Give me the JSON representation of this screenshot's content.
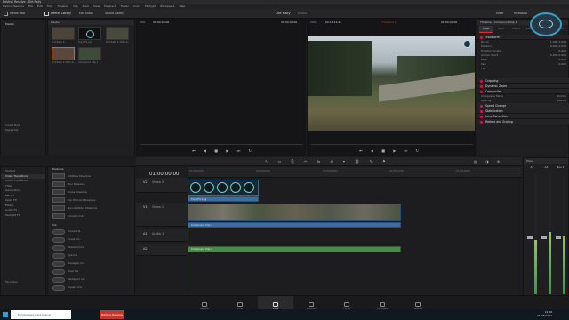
{
  "app": {
    "title": "DaVinci Resolve - Dirt Rally",
    "window_buttons": [
      "–",
      "□",
      "✕"
    ]
  },
  "menu": [
    "DaVinci Resolve",
    "File",
    "Edit",
    "Trim",
    "Timeline",
    "Clip",
    "Mark",
    "View",
    "Playback",
    "Fusion",
    "Color",
    "Fairlight",
    "Workspace",
    "Help"
  ],
  "toolbar": {
    "media_pool": "Media Pool",
    "effects_library": "Effects Library",
    "edit_index": "Edit Index",
    "sound_library": "Sound Library",
    "project": "Dirt Rally",
    "project_state": "Edited",
    "mixer": "Mixer",
    "metadata": "Metadata",
    "inspector": "Inspector"
  },
  "left": {
    "master": "Master",
    "smart_bins": "Smart Bins",
    "keywords": "Keywords",
    "favorites": "Favorites",
    "clips": [
      "Dirt Rally 2...",
      "Top VFX.png",
      "Dirt Rally 2 2021-0...",
      "Dirt Rally 2 2021-0...",
      "Compound Clip 1"
    ],
    "header": "Master"
  },
  "viewer": {
    "zoom_left": "29%",
    "tc_left": "00:00:00:00",
    "tc_right": "00:00:00:00",
    "zoom_right": "29%",
    "dur": "00:11:14:22",
    "timeline_name": "Timeline 1",
    "tc_program": "01:00:00:00"
  },
  "inspector": {
    "title": "Timeline - Compound Clip 1",
    "tabs": [
      "Video",
      "Audio",
      "Effects",
      "Transition",
      "Image",
      "File"
    ],
    "sections": [
      "Transform",
      "Cropping",
      "Dynamic Zoom",
      "Composite",
      "Speed Change",
      "Stabilization",
      "Lens Correction",
      "Retime and Scaling"
    ],
    "transform_rows": [
      {
        "label": "Zoom",
        "x": "1.000",
        "y": "1.000"
      },
      {
        "label": "Position",
        "x": "0.000",
        "y": "0.000"
      },
      {
        "label": "Rotation Angle",
        "x": "0.000",
        "y": ""
      },
      {
        "label": "Anchor Point",
        "x": "0.000",
        "y": "0.000"
      },
      {
        "label": "Pitch",
        "x": "0.000",
        "y": ""
      },
      {
        "label": "Yaw",
        "x": "0.000",
        "y": ""
      },
      {
        "label": "Flip",
        "x": "",
        "y": ""
      }
    ],
    "composite_mode_label": "Composite Mode",
    "composite_mode": "Normal",
    "opacity_label": "Opacity",
    "opacity": "100.00"
  },
  "effects": {
    "toolbox": [
      "Toolbox",
      "Video Transitions",
      "Audio Transitions",
      "Titles",
      "Generators",
      "Effects"
    ],
    "openfx": [
      "Open FX",
      "Filters",
      "Audio FX",
      "Fairlight FX"
    ],
    "transitions_header": "Dissolve",
    "transitions": [
      "Additive Dissolve",
      "Blur Dissolve",
      "Cross Dissolve",
      "Dip To Color Dissolve",
      "Non-Additive Dissolve",
      "Smooth Cut"
    ],
    "iris_header": "Iris",
    "iris": [
      "Arrow Iris",
      "Cross Iris",
      "Diamond Iris",
      "Eye Iris",
      "Hexagon Iris",
      "Oval Iris",
      "Pentagon Iris",
      "Square Iris"
    ]
  },
  "timeline": {
    "tc": "01:00:00:00",
    "ruler": [
      "01:00:00:00",
      "01:00:04:00",
      "01:00:08:00",
      "01:00:12:00",
      "01:00:16:00",
      "01:00:20:00"
    ],
    "v2": "Video 2",
    "v1": "Video 1",
    "a1": "Audio 1",
    "tracks": {
      "v2": "V2",
      "v1": "V1",
      "a1": "A1",
      "a2": "A2"
    },
    "clip_v2": "Top VFX.png",
    "clip_v1": "Compound Clip 1",
    "clip_a1": "Compound Clip 1",
    "clip_a2": "Compound Clip 1"
  },
  "mixer": {
    "title": "Mixer",
    "channels": [
      "A1",
      "A2",
      "Bus 1"
    ],
    "levels": [
      0.45,
      0.52,
      0.48
    ]
  },
  "pages": [
    "Media",
    "Cut",
    "Edit",
    "Fusion",
    "Color",
    "Fairlight",
    "Deliver"
  ],
  "active_page": "Edit",
  "taskbar": {
    "search": "Escribe aquí para buscar",
    "app": "DaVinci Resolve 17",
    "time": "12:00",
    "date": "01/06/2021"
  }
}
